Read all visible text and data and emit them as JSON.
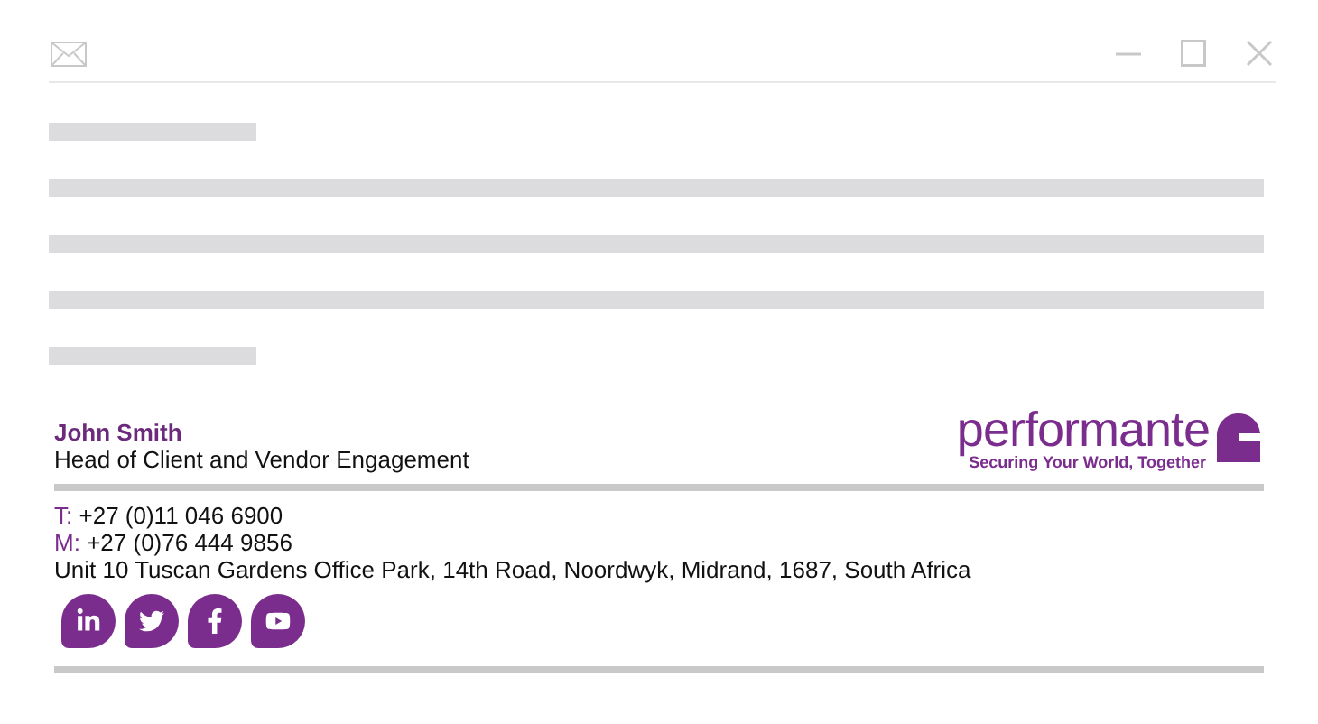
{
  "placeholder_lines": [
    {
      "kind": "short"
    },
    {
      "kind": "long"
    },
    {
      "kind": "long"
    },
    {
      "kind": "long"
    },
    {
      "kind": "short"
    }
  ],
  "signature": {
    "name": "John Smith",
    "job_title": "Head of Client and Vendor Engagement",
    "logo": {
      "wordmark": "performante",
      "tagline": "Securing Your World, Together"
    },
    "phones": [
      {
        "label": "T:",
        "number": "+27 (0)11 046 6900"
      },
      {
        "label": "M:",
        "number": "+27 (0)76 444 9856"
      }
    ],
    "address": "Unit 10 Tuscan Gardens Office Park, 14th Road, Noordwyk, Midrand, 1687, South Africa",
    "social": [
      {
        "kind": "linkedin"
      },
      {
        "kind": "twitter"
      },
      {
        "kind": "facebook"
      },
      {
        "kind": "youtube"
      }
    ]
  }
}
